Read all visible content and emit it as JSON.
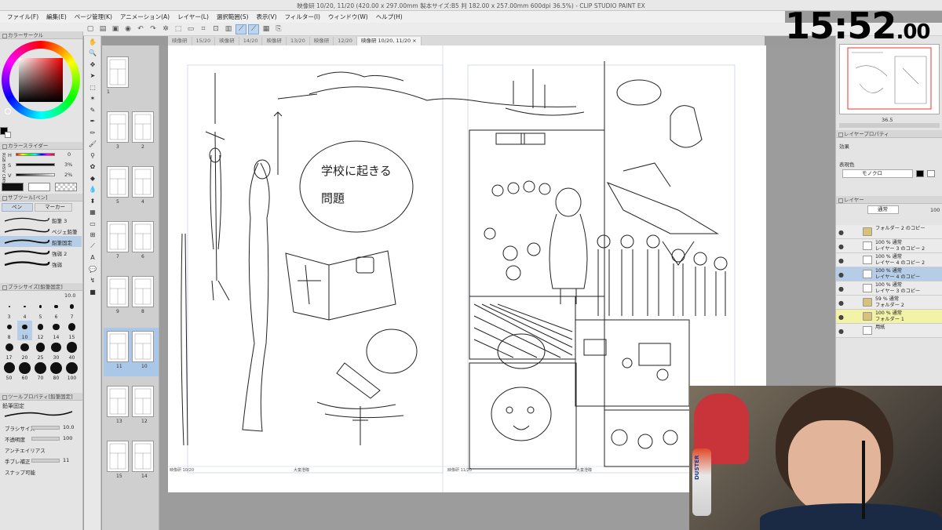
{
  "window": {
    "title": "映像研 10/20, 11/20 (420.00 x 297.00mm 製本サイズ:B5 判 182.00 x 257.00mm 600dpi 36.5%) - CLIP STUDIO PAINT EX"
  },
  "menu": [
    "ファイル(F)",
    "編集(E)",
    "ページ管理(K)",
    "アニメーション(A)",
    "レイヤー(L)",
    "選択範囲(S)",
    "表示(V)",
    "フィルター(I)",
    "ウィンドウ(W)",
    "ヘルプ(H)"
  ],
  "tabs": [
    {
      "label": "映像研",
      "active": false
    },
    {
      "label": "15/20",
      "active": false
    },
    {
      "label": "映像研",
      "active": false
    },
    {
      "label": "14/20",
      "active": false
    },
    {
      "label": "映像研",
      "active": false
    },
    {
      "label": "13/20",
      "active": false
    },
    {
      "label": "映像研",
      "active": false
    },
    {
      "label": "12/20",
      "active": false
    },
    {
      "label": "映像研 10/20, 11/20",
      "active": true
    }
  ],
  "clock": {
    "main": "15:52",
    "sub": ".00"
  },
  "left_panel": {
    "color_circle": {
      "title": "カラーサークル"
    },
    "color_slider": {
      "title": "カラースライダー",
      "tabs": [
        "RGB",
        "HSV",
        "CMY"
      ],
      "rows": [
        {
          "label": "H",
          "value": "0"
        },
        {
          "label": "S",
          "value": "3%"
        },
        {
          "label": "V",
          "value": "2%"
        }
      ]
    },
    "subtool": {
      "title": "サブツール[ペン]",
      "tabs": [
        "ペン",
        "マーカー"
      ],
      "items": [
        "鉛筆 3",
        "ベジェ鉛筆 3",
        "鉛筆固定",
        "強弱 2",
        "強弱"
      ]
    },
    "brush_size": {
      "title": "ブラシサイズ[鉛筆固定]",
      "current": "10.0",
      "sizes": [
        "3",
        "4",
        "5",
        "6",
        "7",
        "8",
        "10",
        "12",
        "14",
        "15",
        "17",
        "20",
        "25",
        "30",
        "40",
        "50",
        "60",
        "70",
        "80",
        "100"
      ]
    },
    "tool_property": {
      "title": "ツールプロパティ[鉛筆固定]",
      "name": "鉛筆固定",
      "rows": [
        {
          "label": "ブラシサイズ",
          "value": "10.0"
        },
        {
          "label": "不透明度",
          "value": "100"
        },
        {
          "label": "アンチエイリアス",
          "value": ""
        },
        {
          "label": "手ブレ補正",
          "value": "11"
        },
        {
          "label": "スナップ可能",
          "value": ""
        }
      ]
    }
  },
  "page_thumbs": [
    {
      "label": "1",
      "slot": "single"
    },
    {
      "label": "3",
      "slot": "left"
    },
    {
      "label": "2",
      "slot": "right"
    },
    {
      "label": "5",
      "slot": "left"
    },
    {
      "label": "4",
      "slot": "right"
    },
    {
      "label": "7",
      "slot": "left"
    },
    {
      "label": "6",
      "slot": "right"
    },
    {
      "label": "9",
      "slot": "left"
    },
    {
      "label": "8",
      "slot": "right"
    },
    {
      "label": "11",
      "slot": "left"
    },
    {
      "label": "10",
      "slot": "right"
    },
    {
      "label": "13",
      "slot": "left"
    },
    {
      "label": "12",
      "slot": "right"
    },
    {
      "label": "15",
      "slot": "left"
    },
    {
      "label": "14",
      "slot": "right"
    }
  ],
  "canvas": {
    "handwritten": "学校に起きる問題",
    "footer_left": [
      "映像研 10/20",
      "大童澄瞳"
    ],
    "footer_right": [
      "映像研 11/20",
      "大童澄瞳"
    ],
    "zoom": "36.5"
  },
  "right_panel": {
    "navigator": {
      "zoom": "36.5"
    },
    "layer_property": {
      "title": "レイヤープロパティ",
      "effect_label": "効果",
      "expression_label": "表現色",
      "expression_value": "モノクロ"
    },
    "layers": {
      "title": "レイヤー",
      "blend": "通常",
      "opacity": "100",
      "items": [
        {
          "name": [
            "フォルダー 2 のコピー"
          ],
          "selected": false,
          "folder": true
        },
        {
          "name": [
            "100 % 通常",
            "レイヤー 3 のコピー 2"
          ],
          "selected": false,
          "folder": false
        },
        {
          "name": [
            "100 % 通常",
            "レイヤー 4 のコピー 2"
          ],
          "selected": false,
          "folder": false
        },
        {
          "name": [
            "100 % 通常",
            "レイヤー 4 のコピー"
          ],
          "selected": true,
          "folder": false
        },
        {
          "name": [
            "100 % 通常",
            "レイヤー 3 のコピー"
          ],
          "selected": false,
          "folder": false
        },
        {
          "name": [
            "59 % 通常",
            "フォルダー 2"
          ],
          "selected": false,
          "folder": true
        },
        {
          "name": [
            "100 % 通常",
            "フォルダー 1"
          ],
          "selected": false,
          "folder": true
        },
        {
          "name": [
            "用紙"
          ],
          "selected": false,
          "folder": false
        }
      ]
    }
  },
  "webcam_overlay": {
    "can_text": "DUSTER"
  }
}
